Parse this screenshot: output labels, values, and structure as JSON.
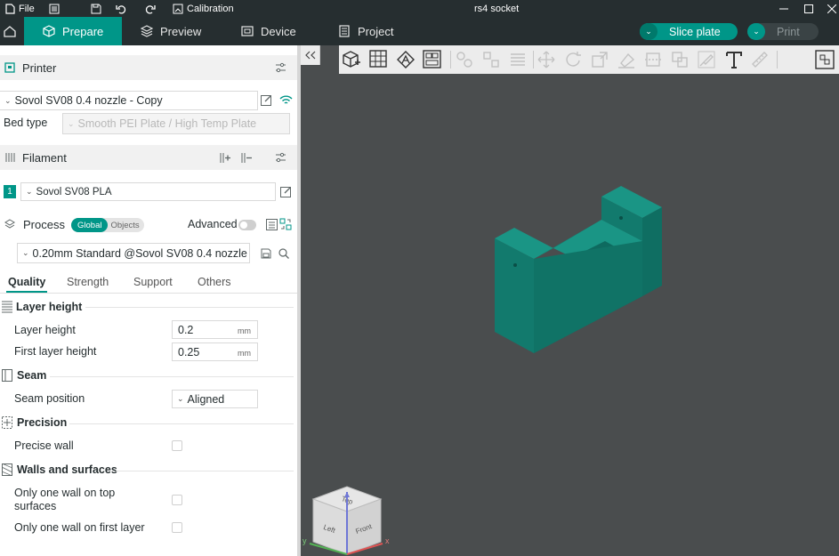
{
  "window": {
    "title": "rs4 socket"
  },
  "menu": {
    "file": "File",
    "calibration": "Calibration"
  },
  "tabs": [
    {
      "label": "Prepare"
    },
    {
      "label": "Preview"
    },
    {
      "label": "Device"
    },
    {
      "label": "Project"
    }
  ],
  "actions": {
    "slice": "Slice plate",
    "print": "Print"
  },
  "printer": {
    "title": "Printer",
    "name": "Sovol SV08 0.4 nozzle - Copy",
    "bed_type_label": "Bed type",
    "bed_type_value": "Smooth PEI Plate / High Temp Plate"
  },
  "filament": {
    "title": "Filament",
    "index": "1",
    "name": "Sovol SV08 PLA"
  },
  "process": {
    "title": "Process",
    "toggle_global": "Global",
    "toggle_objects": "Objects",
    "advanced": "Advanced",
    "preset": "0.20mm Standard @Sovol SV08 0.4 nozzle"
  },
  "settings_tabs": [
    "Quality",
    "Strength",
    "Support",
    "Others"
  ],
  "groups": {
    "layer_height": {
      "title": "Layer height",
      "layer_height_label": "Layer height",
      "layer_height_value": "0.2",
      "first_layer_label": "First layer height",
      "first_layer_value": "0.25",
      "unit": "mm"
    },
    "seam": {
      "title": "Seam",
      "position_label": "Seam position",
      "position_value": "Aligned"
    },
    "precision": {
      "title": "Precision",
      "precise_wall_label": "Precise wall",
      "precise_wall_checked": false
    },
    "walls": {
      "title": "Walls and surfaces",
      "one_wall_top_label": "Only one wall on top surfaces",
      "one_wall_top_checked": false,
      "one_wall_first_label": "Only one wall on first layer",
      "one_wall_first_checked": false
    }
  },
  "navcube": {
    "top": "Top",
    "left": "Left",
    "front": "Front",
    "x": "x",
    "y": "y"
  },
  "colors": {
    "accent": "#009688",
    "titlebar": "#262e30",
    "viewport": "#4a4d4e",
    "model": "#168577"
  }
}
